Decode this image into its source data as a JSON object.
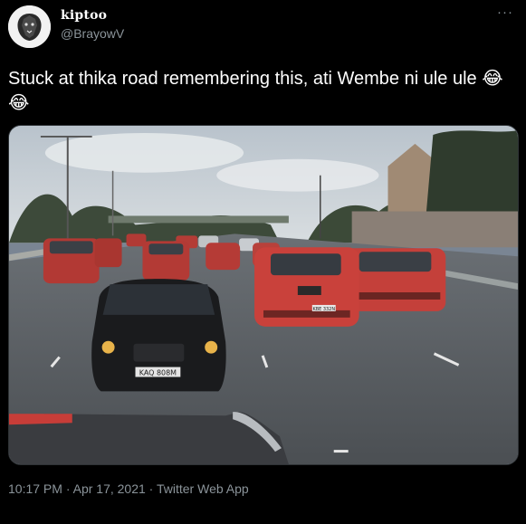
{
  "user": {
    "display_name": "kiptoo",
    "handle": "@BrayowV",
    "avatar_icon": "lion-icon"
  },
  "header": {
    "more_label": "···"
  },
  "tweet": {
    "text_part": "Stuck at thika road remembering this, ati Wembe ni ule ule",
    "emoji_1": "😂",
    "emoji_2": "😂"
  },
  "media": {
    "plate_black_car": "KAQ 808M",
    "plate_suv": "KBE 332N"
  },
  "meta": {
    "time": "10:17 PM",
    "separator_1": " · ",
    "date": "Apr 17, 2021",
    "separator_2": " · ",
    "app": "Twitter Web App"
  },
  "colors": {
    "background": "#000000",
    "text_primary": "#ffffff",
    "text_secondary": "#8b949a",
    "car_red": "#c83a35"
  }
}
